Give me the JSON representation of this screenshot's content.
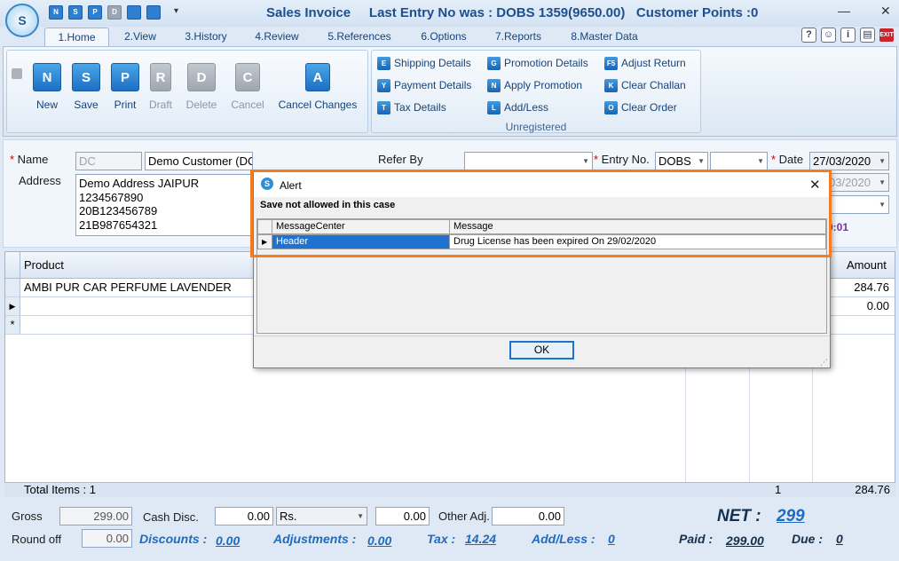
{
  "window": {
    "title": "Sales Invoice",
    "last_entry": "Last Entry No was : DOBS 1359(9650.00)",
    "customer_points": "Customer Points :0",
    "minimize": "—",
    "close": "✕"
  },
  "quick_access": [
    "N",
    "S",
    "P",
    "D",
    "",
    ""
  ],
  "tabs": [
    {
      "label": "1.Home"
    },
    {
      "label": "2.View"
    },
    {
      "label": "3.History"
    },
    {
      "label": "4.Review"
    },
    {
      "label": "5.References"
    },
    {
      "label": "6.Options"
    },
    {
      "label": "7.Reports"
    },
    {
      "label": "8.Master Data"
    }
  ],
  "ribbon": {
    "buttons": [
      {
        "label": "New",
        "icon": "N"
      },
      {
        "label": "Save",
        "icon": "S"
      },
      {
        "label": "Print",
        "icon": "P"
      },
      {
        "label": "Draft",
        "icon": "R"
      },
      {
        "label": "Delete",
        "icon": "D"
      },
      {
        "label": "Cancel",
        "icon": "C"
      },
      {
        "label": "Cancel Changes",
        "icon": "A"
      }
    ],
    "small": [
      {
        "label": "Shipping Details",
        "icon": "E"
      },
      {
        "label": "Promotion Details",
        "icon": "G"
      },
      {
        "label": "Adjust Return",
        "icon": "F5"
      },
      {
        "label": "Payment Details",
        "icon": "Y"
      },
      {
        "label": "Apply Promotion",
        "icon": "N"
      },
      {
        "label": "Clear Challan",
        "icon": "K"
      },
      {
        "label": "Tax Details",
        "icon": "T"
      },
      {
        "label": "Add/Less",
        "icon": "L"
      },
      {
        "label": "Clear Order",
        "icon": "O"
      }
    ],
    "group_label": "Unregistered"
  },
  "form": {
    "name_label": "Name",
    "name_code": "DC",
    "name_value": "Demo Customer (DC)",
    "refer_by_label": "Refer By",
    "entry_no_label": "Entry No.",
    "entry_prefix": "DOBS",
    "date_label": "Date",
    "date_value": "27/03/2020",
    "date2_value": "03/2020",
    "points_value": "0:01",
    "address_label": "Address",
    "address_lines": [
      "Demo Address JAIPUR",
      "1234567890",
      "20B123456789",
      "21B987654321"
    ]
  },
  "grid": {
    "col_product": "Product",
    "col_amount": "Amount",
    "rows": [
      {
        "product": "AMBI PUR CAR PERFUME LAVENDER",
        "amount": "284.76"
      },
      {
        "product": "",
        "amount": "0.00"
      }
    ],
    "total_items": "Total Items : 1",
    "total_qty": "1",
    "total_amount": "284.76"
  },
  "footer": {
    "gross_label": "Gross",
    "gross_value": "299.00",
    "cash_disc_label": "Cash Disc.",
    "cash_disc_value": "0.00",
    "rs_label": "Rs.",
    "rs_value": "0.00",
    "other_adj_label": "Other Adj.",
    "other_adj_value": "0.00",
    "net_label": "NET :",
    "net_value": "299",
    "round_off_label": "Round off",
    "round_off_value": "0.00",
    "discounts_label": "Discounts :",
    "discounts_value": "0.00",
    "adjustments_label": "Adjustments :",
    "adjustments_value": "0.00",
    "tax_label": "Tax :",
    "tax_value": "14.24",
    "addless_label": "Add/Less :",
    "addless_value": "0",
    "paid_label": "Paid :",
    "paid_value": "299.00",
    "due_label": "Due :",
    "due_value": "0"
  },
  "dialog": {
    "title": "Alert",
    "heading": "Save not allowed in this case",
    "col1": "MessageCenter",
    "col2": "Message",
    "row_center": "Header",
    "row_message": "Drug License has been expired On 29/02/2020",
    "ok_label": "OK"
  },
  "colors": {
    "accent": "#1f6bbf",
    "highlight": "#f57c20",
    "selection": "#1e73d2"
  }
}
